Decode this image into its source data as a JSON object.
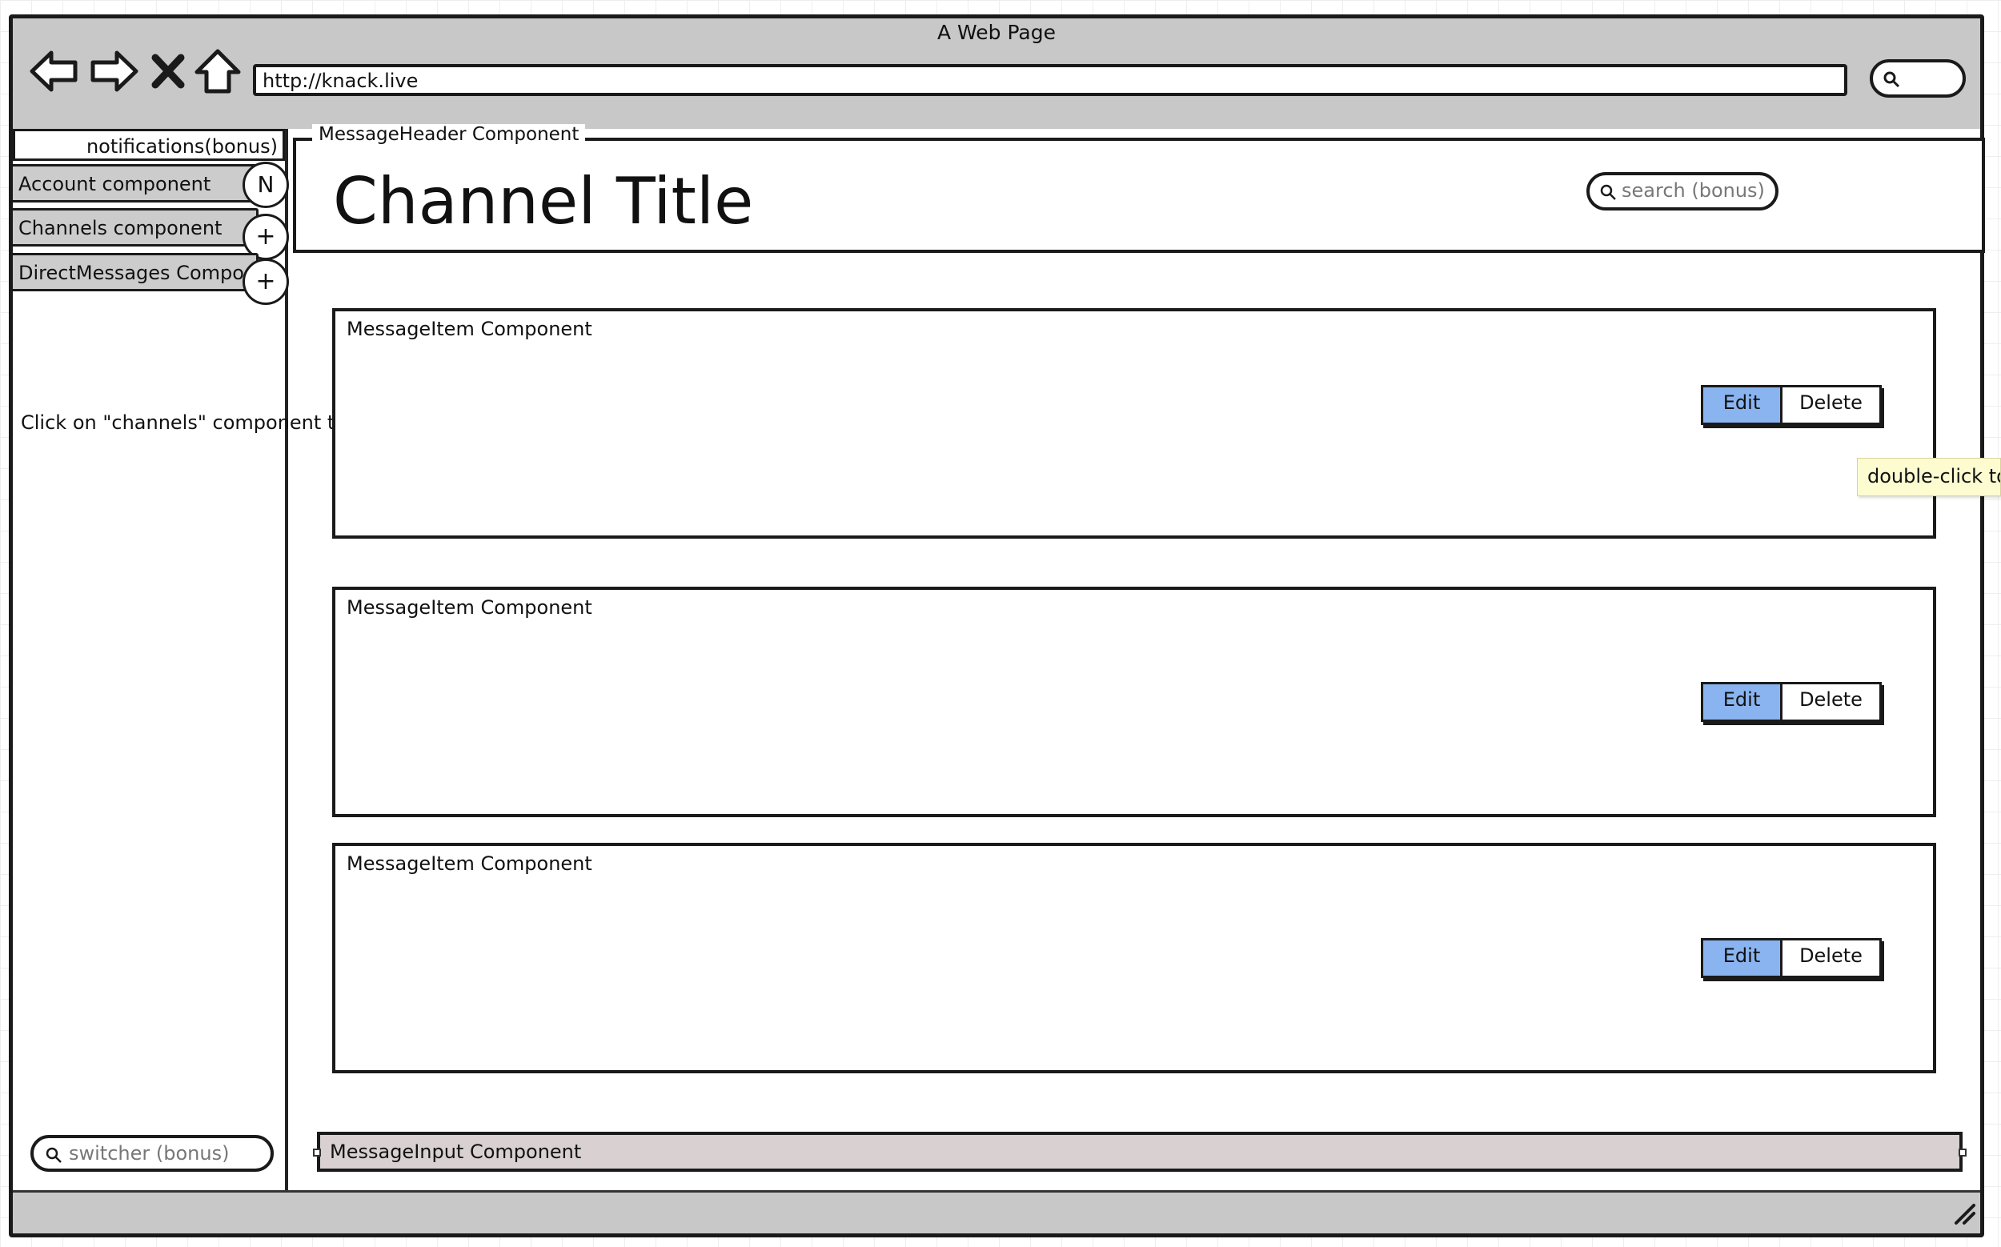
{
  "browser": {
    "title": "A Web Page",
    "url": "http://knack.live",
    "nav_icons": [
      "back-arrow-icon",
      "forward-arrow-icon",
      "close-x-icon",
      "home-icon"
    ]
  },
  "sidebar": {
    "notifications_label": "notifications(bonus)",
    "items": [
      {
        "label": "Account component",
        "button": "N"
      },
      {
        "label": "Channels component",
        "button": "+"
      },
      {
        "label": "DirectMessages Compo",
        "button": "+"
      }
    ],
    "annotation": "Click on \"channels\" component text goes to browse channels",
    "switcher_placeholder": "switcher (bonus)"
  },
  "header": {
    "legend": "MessageHeader Component",
    "title": "Channel Title",
    "search_placeholder": "search (bonus)"
  },
  "messages": [
    {
      "label": "MessageItem Component",
      "edit": "Edit",
      "delete": "Delete"
    },
    {
      "label": "MessageItem Component",
      "edit": "Edit",
      "delete": "Delete"
    },
    {
      "label": "MessageItem Component",
      "edit": "Edit",
      "delete": "Delete"
    }
  ],
  "tooltip": "double-click to",
  "input": {
    "label": "MessageInput Component"
  },
  "colors": {
    "chrome": "#c8c8c8",
    "edit_button": "#8ab4f0",
    "input_bg": "#d9d1d1",
    "tooltip_bg": "#fdfbd0"
  }
}
